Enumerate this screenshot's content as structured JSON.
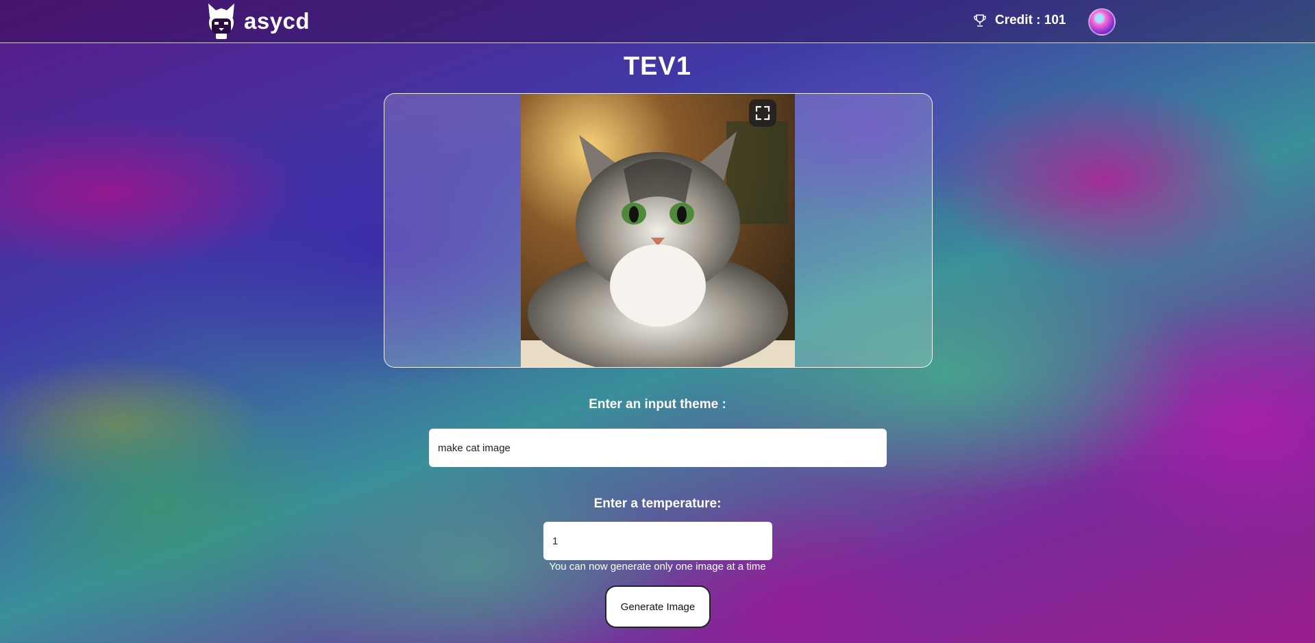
{
  "header": {
    "brand_name": "asycd",
    "logo_icon": "cat-helmet-logo-icon",
    "credit_icon": "trophy-icon",
    "credit_text": "Credit : 101",
    "avatar_icon": "user-avatar"
  },
  "main": {
    "title": "TEV1",
    "preview": {
      "image_subject": "cat",
      "fullscreen_icon": "fullscreen-icon"
    },
    "theme": {
      "label": "Enter an input theme :",
      "value": "make cat image"
    },
    "temperature": {
      "label": "Enter a temperature:",
      "value": "1"
    },
    "hint": "You can now generate only one image at a time",
    "generate_label": "Generate Image"
  },
  "colors": {
    "button_bg": "#ffffff",
    "text": "#ffffff"
  }
}
